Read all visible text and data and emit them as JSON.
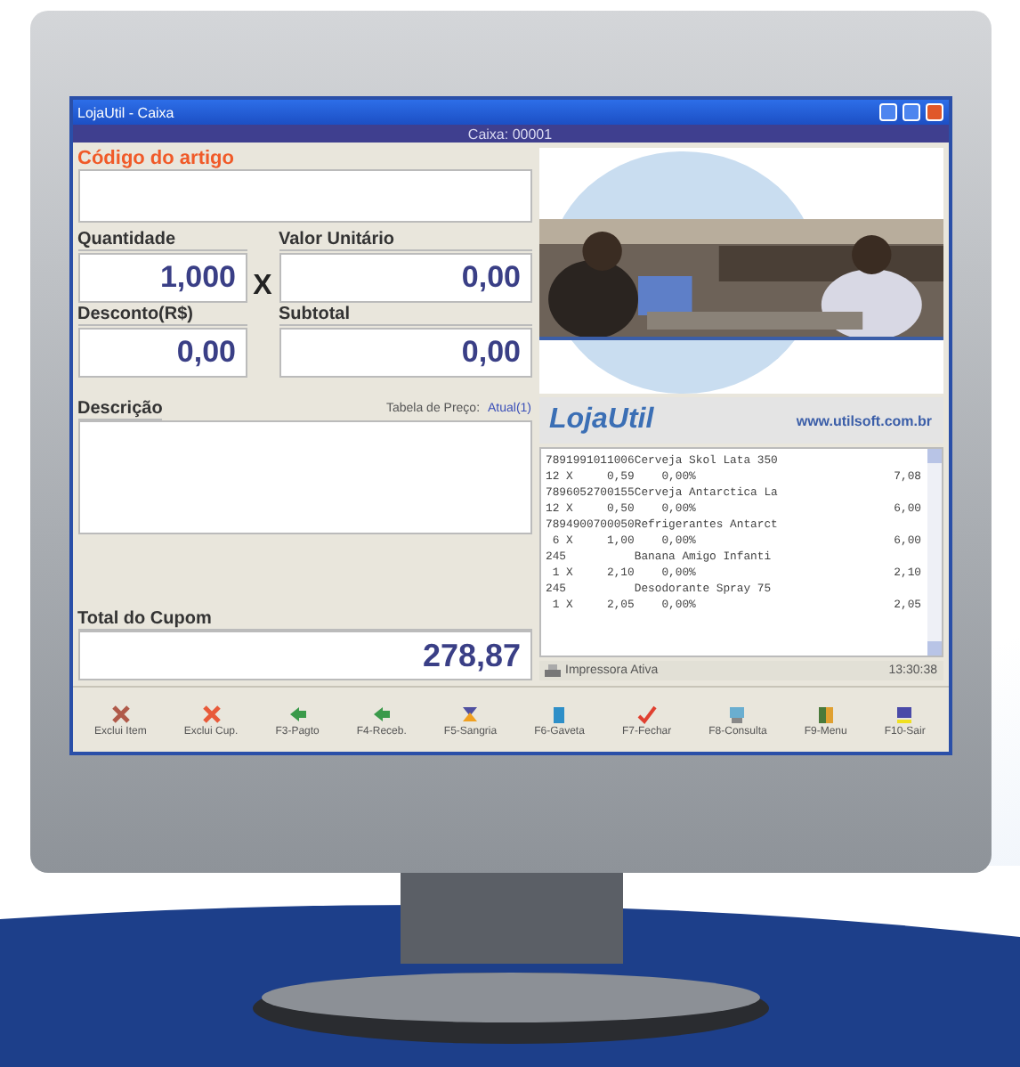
{
  "window": {
    "title": "LojaUtil - Caixa",
    "register": "Caixa: 00001"
  },
  "form": {
    "code_label": "Código do artigo",
    "quantity": {
      "label": "Quantidade",
      "value": "1,000"
    },
    "times": "X",
    "unit_price": {
      "label": "Valor Unitário",
      "value": "0,00"
    },
    "discount": {
      "label": "Desconto(R$)",
      "value": "0,00"
    },
    "subtotal": {
      "label": "Subtotal",
      "value": "0,00"
    },
    "price_table": {
      "label": "Tabela de Preço:",
      "value": "Atual(1)"
    },
    "description_label": "Descrição",
    "total": {
      "label": "Total do Cupom",
      "value": "278,87"
    }
  },
  "banner": {
    "logo": "LojaUtil",
    "url": "www.utilsoft.com.br"
  },
  "receipt": [
    {
      "item": "7891991011006Cerveja Skol Lata 350",
      "detail": "12 X     0,59    0,00%",
      "amount": "7,08"
    },
    {
      "item": "7896052700155Cerveja Antarctica La",
      "detail": "12 X     0,50    0,00%",
      "amount": "6,00"
    },
    {
      "item": "7894900700050Refrigerantes Antarct",
      "detail": " 6 X     1,00    0,00%",
      "amount": "6,00"
    },
    {
      "item": "245          Banana Amigo Infanti",
      "detail": " 1 X     2,10    0,00%",
      "amount": "2,10"
    },
    {
      "item": "245          Desodorante Spray 75",
      "detail": " 1 X     2,05    0,00%",
      "amount": "2,05"
    }
  ],
  "status_bar": {
    "printer": "Impressora Ativa",
    "time": "13:30:38"
  },
  "toolbar": [
    {
      "kind": "delete",
      "label": "Exclui Item"
    },
    {
      "kind": "delete",
      "label": "Exclui Cup."
    },
    {
      "kind": "arrow",
      "label": "F3-Pagto"
    },
    {
      "kind": "arrow",
      "label": "F4-Receb."
    },
    {
      "kind": "flag",
      "label": "F5-Sangria"
    },
    {
      "kind": "box",
      "label": "F6-Gaveta"
    },
    {
      "kind": "check",
      "label": "F7-Fechar"
    },
    {
      "kind": "screen",
      "label": "F8-Consulta"
    },
    {
      "kind": "book",
      "label": "F9-Menu"
    },
    {
      "kind": "printer",
      "label": "F10-Sair"
    }
  ]
}
